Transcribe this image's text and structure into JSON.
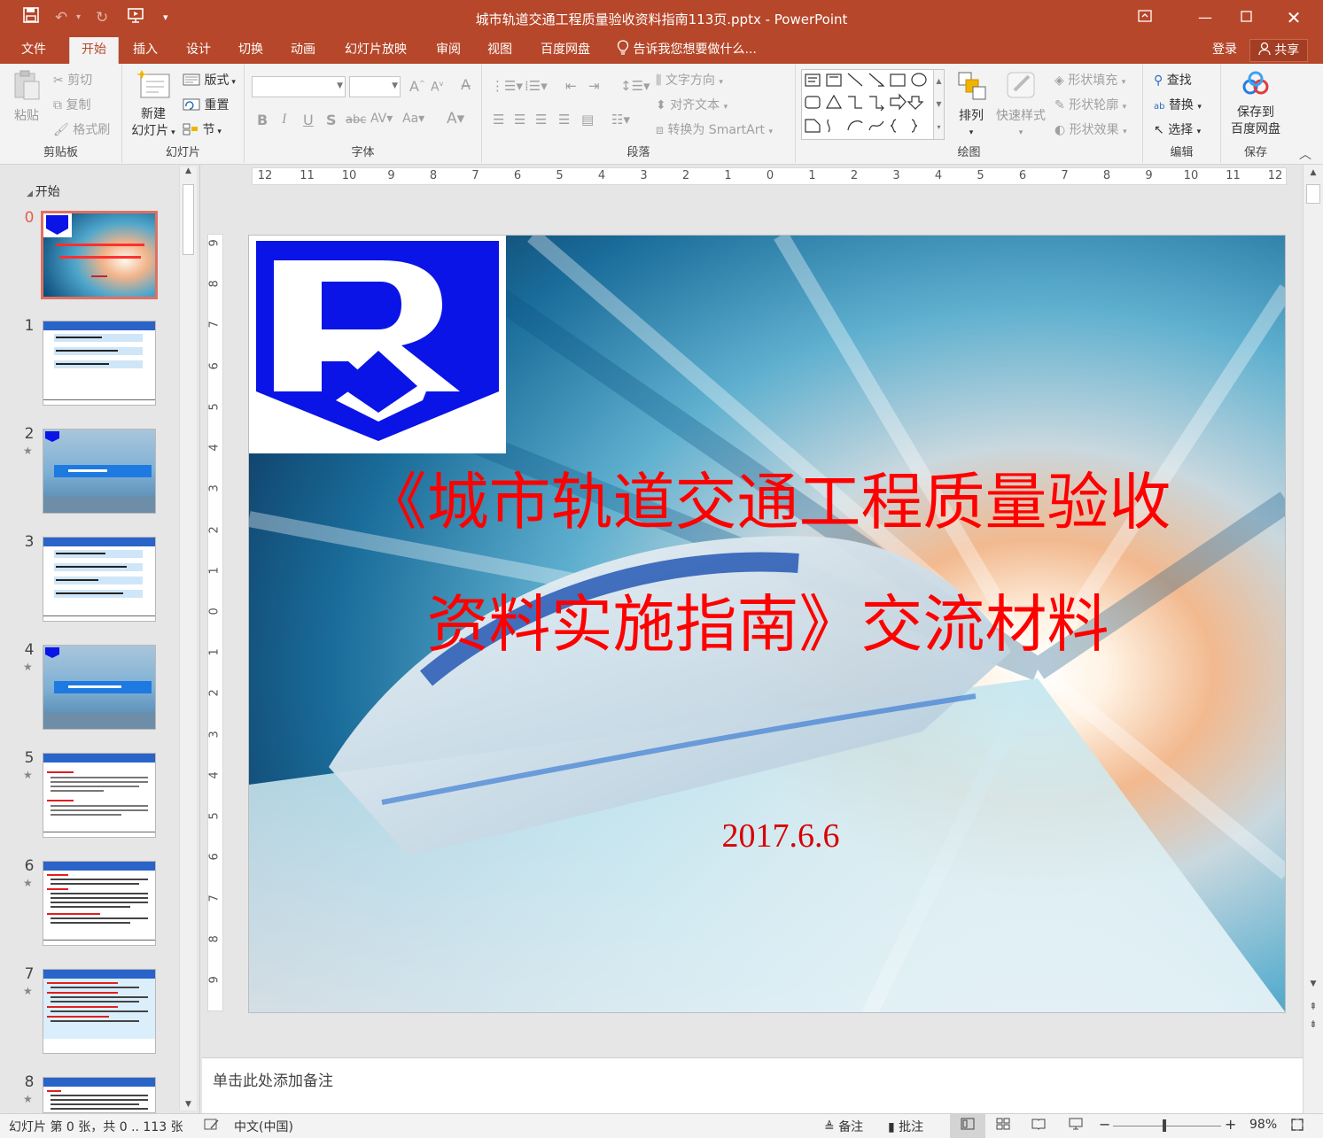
{
  "window": {
    "title": "城市轨道交通工程质量验收资料指南113页.pptx - PowerPoint"
  },
  "tabs": [
    {
      "label": "文件"
    },
    {
      "label": "开始"
    },
    {
      "label": "插入"
    },
    {
      "label": "设计"
    },
    {
      "label": "切换"
    },
    {
      "label": "动画"
    },
    {
      "label": "幻灯片放映"
    },
    {
      "label": "审阅"
    },
    {
      "label": "视图"
    },
    {
      "label": "百度网盘"
    }
  ],
  "tellme": "告诉我您想要做什么...",
  "account": {
    "login": "登录",
    "share": "共享"
  },
  "ribbon": {
    "clipboard": {
      "paste": "粘贴",
      "cut": "剪切",
      "copy": "复制",
      "format_painter": "格式刷",
      "label": "剪贴板"
    },
    "slides": {
      "new_slide_line1": "新建",
      "new_slide_line2": "幻灯片",
      "layout": "版式",
      "reset": "重置",
      "section": "节",
      "label": "幻灯片"
    },
    "font": {
      "label": "字体"
    },
    "paragraph": {
      "text_direction": "文字方向",
      "align_text": "对齐文本",
      "smartart": "转换为 SmartArt",
      "label": "段落"
    },
    "drawing": {
      "arrange": "排列",
      "quick_styles": "快速样式",
      "shape_fill": "形状填充",
      "shape_outline": "形状轮廓",
      "shape_effects": "形状效果",
      "label": "绘图"
    },
    "editing": {
      "find": "查找",
      "replace": "替换",
      "select": "选择",
      "label": "编辑"
    },
    "save": {
      "save_line1": "保存到",
      "save_line2": "百度网盘",
      "label": "保存"
    }
  },
  "ruler": {
    "h_ticks": [
      "12",
      "11",
      "10",
      "9",
      "8",
      "7",
      "6",
      "5",
      "4",
      "3",
      "2",
      "1",
      "0",
      "1",
      "2",
      "3",
      "4",
      "5",
      "6",
      "7",
      "8",
      "9",
      "10",
      "11",
      "12"
    ],
    "v_ticks": [
      "9",
      "8",
      "7",
      "6",
      "5",
      "4",
      "3",
      "2",
      "1",
      "0",
      "1",
      "2",
      "3",
      "4",
      "5",
      "6",
      "7",
      "8",
      "9"
    ]
  },
  "slides_panel": {
    "section": "开始",
    "thumbnails": [
      {
        "num": "0",
        "star": ""
      },
      {
        "num": "1",
        "star": ""
      },
      {
        "num": "2",
        "star": "★"
      },
      {
        "num": "3",
        "star": ""
      },
      {
        "num": "4",
        "star": "★"
      },
      {
        "num": "5",
        "star": "★"
      },
      {
        "num": "6",
        "star": "★"
      },
      {
        "num": "7",
        "star": "★"
      },
      {
        "num": "8",
        "star": "★"
      }
    ]
  },
  "slide": {
    "title_line1": "《城市轨道交通工程质量验收",
    "title_line2": "资料实施指南》交流材料",
    "date": "2017.6.6"
  },
  "notes": {
    "placeholder": "单击此处添加备注"
  },
  "status": {
    "slide_info": "幻灯片 第 0 张，共 0 .. 113 张",
    "language": "中文(中国)",
    "notes": "备注",
    "comments": "批注",
    "zoom": "98%"
  },
  "colors": {
    "brand": "#b7472a",
    "title_red": "#ff0000",
    "logo_blue": "#0a14e6"
  }
}
